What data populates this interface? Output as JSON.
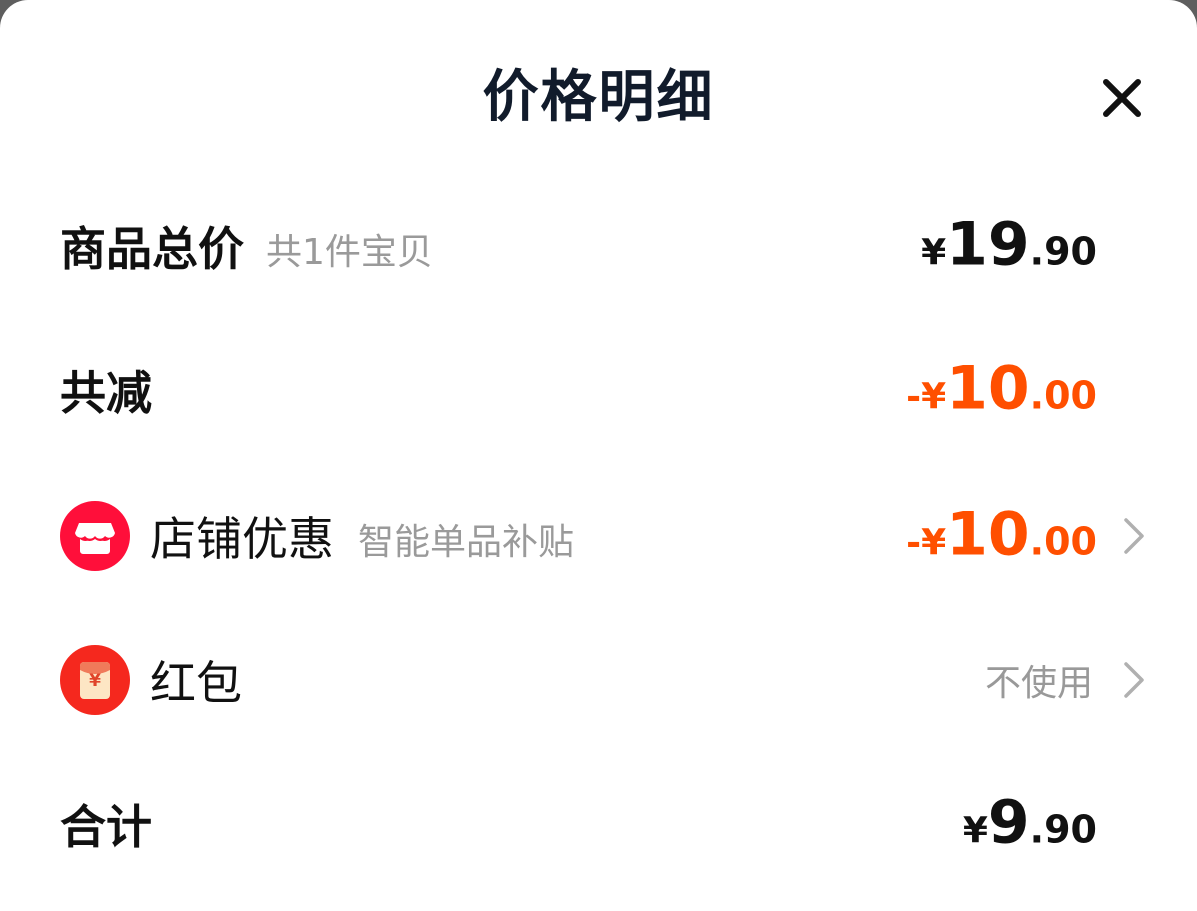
{
  "header": {
    "title": "价格明细",
    "close_icon": "close-icon"
  },
  "rows": {
    "subtotal": {
      "label": "商品总价",
      "note": "共1件宝贝",
      "currency": "¥",
      "amount_int": "19",
      "amount_dec": ".90"
    },
    "discount_total": {
      "label": "共减",
      "prefix": "-",
      "currency": "¥",
      "amount_int": "10",
      "amount_dec": ".00"
    },
    "store_discount": {
      "icon": "store-icon",
      "label": "店铺优惠",
      "note": "智能单品补贴",
      "prefix": "-",
      "currency": "¥",
      "amount_int": "10",
      "amount_dec": ".00"
    },
    "red_packet": {
      "icon": "red-packet-icon",
      "label": "红包",
      "status": "不使用",
      "icon_symbol": "¥"
    },
    "total": {
      "label": "合计",
      "currency": "¥",
      "amount_int": "9",
      "amount_dec": ".90"
    }
  },
  "colors": {
    "accent_orange": "#ff4f00",
    "store_icon_red": "#ff0f3a",
    "red_packet_red": "#f5281e",
    "title_dark": "#111b2b"
  }
}
